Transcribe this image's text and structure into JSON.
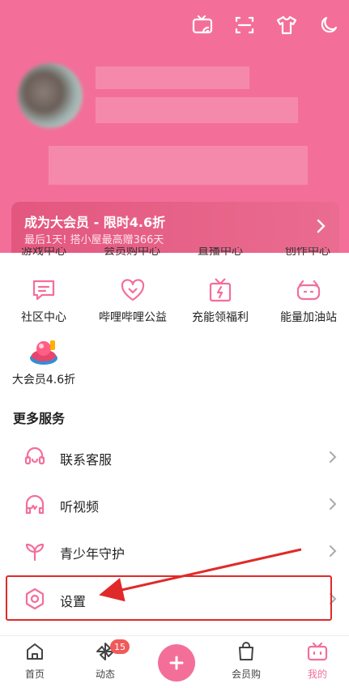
{
  "vip": {
    "title": "成为大会员 - 限时4.6折",
    "subtitle": "最后1天! 搭小屋最高赠366天"
  },
  "clipped_row": [
    "游戏中心",
    "会员购中心",
    "直播中心",
    "创作中心"
  ],
  "grid": [
    {
      "label": "社区中心",
      "icon": "community-chat-icon"
    },
    {
      "label": "哔哩哔哩公益",
      "icon": "charity-heart-icon"
    },
    {
      "label": "充能领福利",
      "icon": "charge-gift-icon"
    },
    {
      "label": "能量加油站",
      "icon": "energy-station-icon"
    },
    {
      "label": "大会员4.6折",
      "icon": "vip-discount-icon"
    }
  ],
  "more_services": {
    "title": "更多服务",
    "items": [
      {
        "label": "联系客服",
        "icon": "customer-service-icon"
      },
      {
        "label": "听视频",
        "icon": "headphones-icon"
      },
      {
        "label": "青少年守护",
        "icon": "sprout-icon"
      },
      {
        "label": "设置",
        "icon": "settings-icon"
      }
    ]
  },
  "tabbar": {
    "items": [
      {
        "label": "首页",
        "icon": "home-icon"
      },
      {
        "label": "动态",
        "icon": "pinwheel-icon",
        "badge": "15"
      },
      {
        "label": "",
        "icon": "plus-icon"
      },
      {
        "label": "会员购",
        "icon": "shopping-bag-icon"
      },
      {
        "label": "我的",
        "icon": "tv-profile-icon"
      }
    ]
  },
  "colors": {
    "brand_pink": "#f36f9a",
    "annotation_red": "#e02a2a"
  }
}
